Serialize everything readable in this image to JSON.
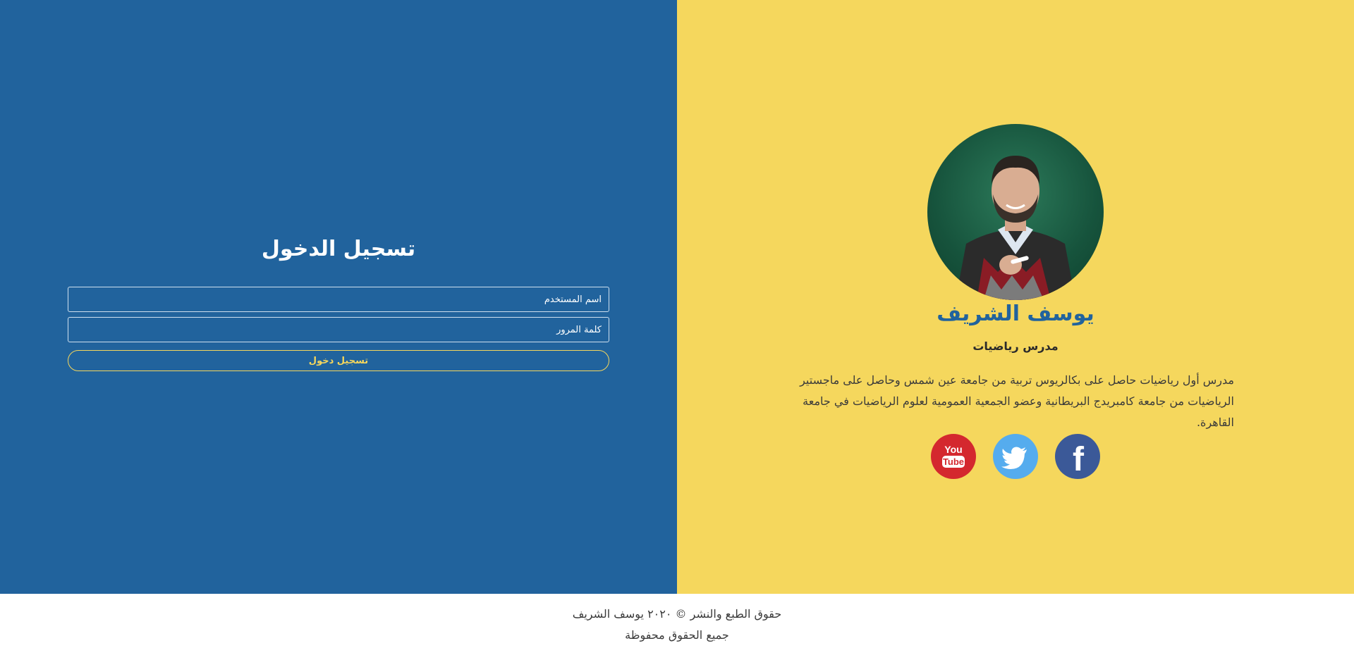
{
  "login": {
    "title": "تسجيل الدخول",
    "username_placeholder": "اسم المستخدم",
    "password_placeholder": "كلمة المرور",
    "submit_label": "تسجيل دخول"
  },
  "profile": {
    "name": "يوسف الشريف",
    "role": "مدرس رياضيات",
    "bio": "مدرس أول رياضيات حاصل على بكالريوس تربية من جامعة عين شمس وحاصل على ماجستير الرياضيات من جامعة كامبريدج البريطانية وعضو الجمعية العمومية لعلوم الرياضيات في جامعة القاهرة.",
    "social": [
      {
        "icon": "youtube-icon",
        "text_top": "You",
        "text_bottom": "Tube",
        "color": "#d4282e"
      },
      {
        "icon": "twitter-icon",
        "color": "#55acee"
      },
      {
        "icon": "facebook-icon",
        "glyph": "f",
        "color": "#3b5998"
      }
    ]
  },
  "footer": {
    "copyright": "حقوق الطبع والنشر © ٢٠٢٠ يوسف الشريف",
    "rights": "جميع الحقوق محفوظة"
  },
  "colors": {
    "login_bg": "#21639d",
    "profile_bg": "#f5d75d",
    "accent_yellow": "#f5d65c",
    "name_blue": "#21639d"
  }
}
